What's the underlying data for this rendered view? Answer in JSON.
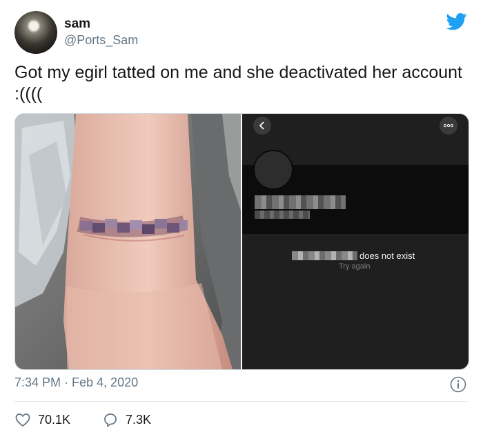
{
  "user": {
    "name": "sam",
    "handle": "@Ports_Sam"
  },
  "tweet": {
    "text": "Got my egirl tatted on me and she deactivated her account :((((",
    "timestamp": "7:34 PM · Feb 4, 2020"
  },
  "media": {
    "right_panel": {
      "message_suffix": "does not exist",
      "retry": "Try again"
    }
  },
  "stats": {
    "likes": "70.1K",
    "replies": "7.3K"
  },
  "icons": {
    "avatar": "avatar",
    "brand": "twitter-bird-icon",
    "info": "info-icon",
    "like": "heart-icon",
    "reply": "reply-bubble-icon",
    "back": "chevron-left-icon",
    "more": "more-dots-icon"
  },
  "colors": {
    "twitter_blue": "#1da1f2",
    "muted": "#657786",
    "text": "#14171a"
  }
}
